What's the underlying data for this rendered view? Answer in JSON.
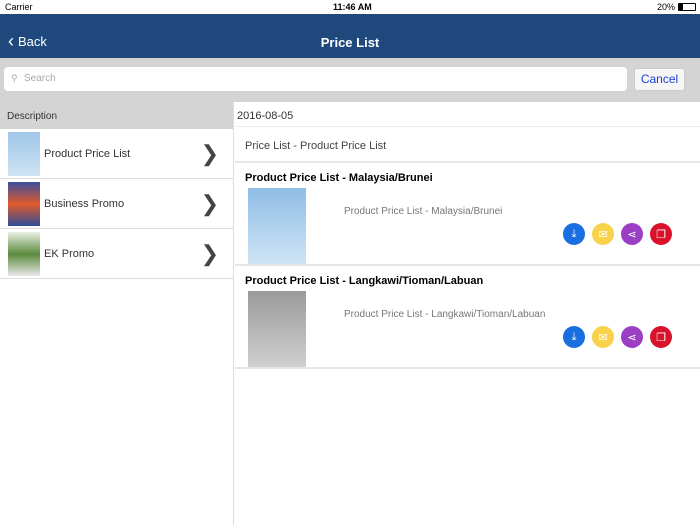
{
  "status": {
    "carrier": "Carrier",
    "time": "11:46 AM",
    "battery": "20%"
  },
  "nav": {
    "back": "Back",
    "title": "Price List"
  },
  "search": {
    "placeholder": "Search",
    "cancel": "Cancel"
  },
  "sidebar": {
    "header": "Description",
    "items": [
      {
        "label": "Product Price List"
      },
      {
        "label": "Business Promo"
      },
      {
        "label": "EK Promo"
      }
    ]
  },
  "main": {
    "date": "2016-08-05",
    "section": "Price List - Product Price List",
    "items": [
      {
        "title": "Product Price List - Malaysia/Brunei",
        "desc": "Product Price List - Malaysia/Brunei"
      },
      {
        "title": "Product Price List - Langkawi/Tioman/Labuan",
        "desc": "Product Price List - Langkawi/Tioman/Labuan"
      }
    ]
  },
  "colors": {
    "nav": "#1f497d",
    "download": "#1a6fe0",
    "email": "#f7d24a",
    "share": "#9b3fc4",
    "pdf": "#d8122a"
  }
}
